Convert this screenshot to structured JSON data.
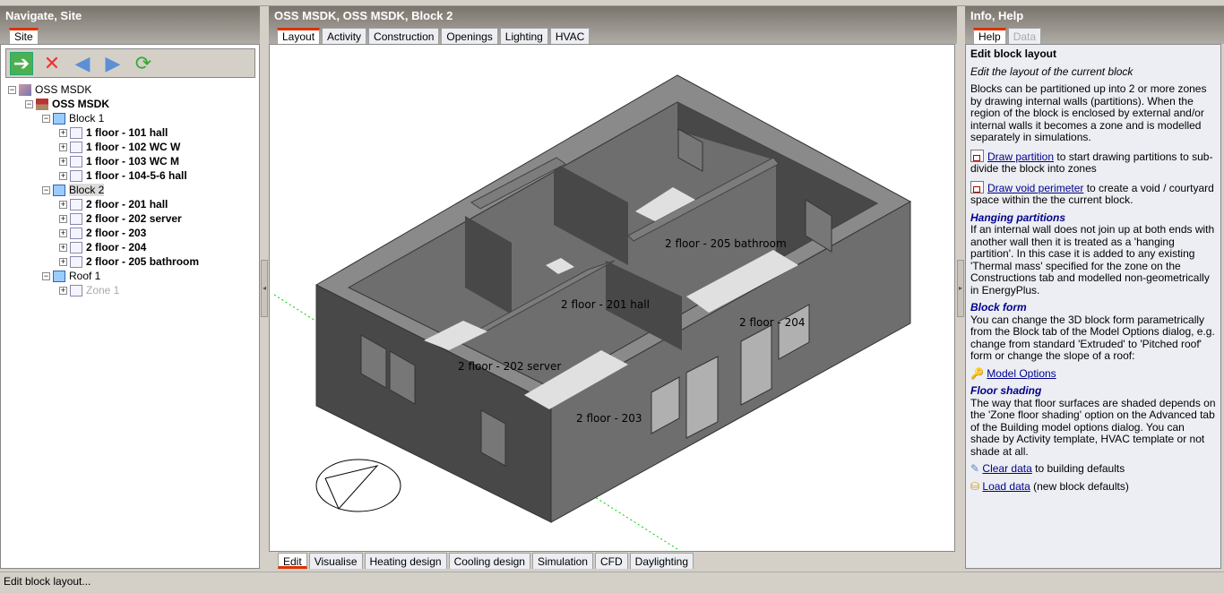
{
  "left_panel": {
    "title": "Navigate, Site",
    "tab": "Site",
    "toolbar": [
      "go-arrow-icon",
      "delete-document-icon",
      "back-arrow-icon",
      "forward-arrow-icon",
      "refresh-icon"
    ],
    "tree": [
      {
        "label": "OSS MSDK",
        "level": 0,
        "bold": false,
        "icon": "site-icon"
      },
      {
        "label": "OSS MSDK",
        "level": 1,
        "bold": true,
        "icon": "building-icon"
      },
      {
        "label": "Block 1",
        "level": 2,
        "bold": false,
        "icon": "block-icon"
      },
      {
        "label": "1 floor - 101 hall",
        "level": 3,
        "bold": true,
        "icon": "zone-icon"
      },
      {
        "label": "1 floor - 102 WC W",
        "level": 3,
        "bold": true,
        "icon": "zone-icon"
      },
      {
        "label": "1 floor - 103 WC M",
        "level": 3,
        "bold": true,
        "icon": "zone-icon"
      },
      {
        "label": "1 floor - 104-5-6 hall",
        "level": 3,
        "bold": true,
        "icon": "zone-icon"
      },
      {
        "label": "Block 2",
        "level": 2,
        "bold": false,
        "icon": "block-icon",
        "selected": true
      },
      {
        "label": "2 floor - 201 hall",
        "level": 3,
        "bold": true,
        "icon": "zone-icon"
      },
      {
        "label": "2 floor - 202 server",
        "level": 3,
        "bold": true,
        "icon": "zone-icon"
      },
      {
        "label": "2 floor - 203",
        "level": 3,
        "bold": true,
        "icon": "zone-icon"
      },
      {
        "label": "2 floor - 204",
        "level": 3,
        "bold": true,
        "icon": "zone-icon"
      },
      {
        "label": "2 floor - 205 bathroom",
        "level": 3,
        "bold": true,
        "icon": "zone-icon"
      },
      {
        "label": "Roof 1",
        "level": 2,
        "bold": false,
        "icon": "block-icon"
      },
      {
        "label": "Zone 1",
        "level": 3,
        "bold": false,
        "icon": "zone-icon",
        "disabled": true
      }
    ]
  },
  "center": {
    "title": "OSS MSDK, OSS MSDK, Block 2",
    "tabs": [
      "Layout",
      "Activity",
      "Construction",
      "Openings",
      "Lighting",
      "HVAC"
    ],
    "zone_labels": [
      "2 floor - 205 bathroom",
      "2 floor - 201 hall",
      "2 floor - 204",
      "2 floor - 202 server",
      "2 floor - 203"
    ],
    "bottom_tabs": [
      "Edit",
      "Visualise",
      "Heating design",
      "Cooling design",
      "Simulation",
      "CFD",
      "Daylighting"
    ]
  },
  "right_panel": {
    "title": "Info, Help",
    "tabs": [
      "Help",
      "Data"
    ],
    "heading": "Edit block layout",
    "subtitle": "Edit the layout of the current block",
    "intro": "Blocks can be partitioned up into 2 or more zones by drawing internal walls (partitions). When the region of the block is enclosed by external and/or internal walls it becomes a zone and is modelled separately in simulations.",
    "draw_partition_link": "Draw partition",
    "draw_partition_text": " to start drawing partitions to sub-divide the block into zones",
    "draw_void_link": "Draw void perimeter",
    "draw_void_text": " to create a void / courtyard space within the the current block.",
    "hanging_heading": "Hanging partitions",
    "hanging_text": "If an internal wall does not join up at both ends with another wall then it is treated as a 'hanging partition'.  In this case it is added to any existing 'Thermal mass' specified for the zone on the Constructions tab and modelled non-geometrically in EnergyPlus.",
    "blockform_heading": "Block form",
    "blockform_text": "You can change the 3D block form parametrically from the Block tab of the Model Options dialog, e.g. change from standard 'Extruded' to 'Pitched roof' form or change the slope of a roof:",
    "model_options_link": "Model Options",
    "floor_heading": "Floor shading",
    "floor_text": "The way that floor surfaces are shaded depends on the 'Zone floor shading' option on the Advanced tab of the Building model options dialog. You can shade by Activity template, HVAC template or not shade at all.",
    "clear_link": "Clear data",
    "clear_text": " to building defaults",
    "load_link": "Load data",
    "load_text": " (new block defaults)"
  },
  "status": "Edit block layout..."
}
